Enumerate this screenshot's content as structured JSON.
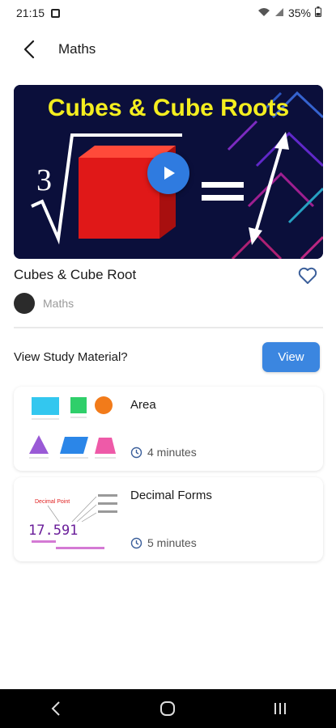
{
  "status_bar": {
    "time": "21:15",
    "battery": "35%"
  },
  "header": {
    "title": "Maths"
  },
  "video": {
    "thumbnail_title": "Cubes & Cube Roots",
    "root_index": "3",
    "equals": "="
  },
  "course": {
    "title": "Cubes & Cube Root",
    "category": "Maths"
  },
  "study": {
    "label": "View Study Material?",
    "button": "View"
  },
  "lessons": [
    {
      "title": "Area",
      "duration": "4 minutes"
    },
    {
      "title": "Decimal Forms",
      "duration": "5 minutes",
      "thumb_number": "17.591",
      "thumb_caption": "Decimal Point"
    }
  ],
  "colors": {
    "accent": "#3b86e0",
    "video_bg": "#0b0f3b",
    "cube_red": "#e01818",
    "title_yellow": "#f4ee1f"
  }
}
